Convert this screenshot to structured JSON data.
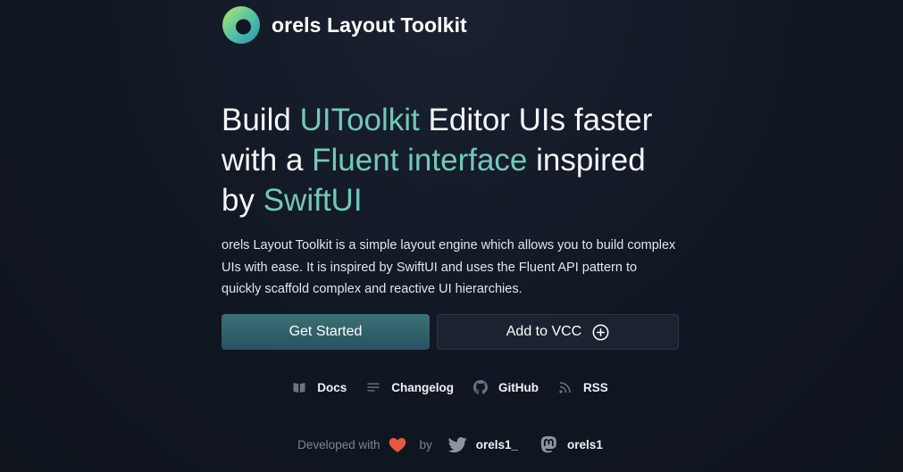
{
  "brand": {
    "name": "orels Layout Toolkit",
    "icon": "logo-ring-icon"
  },
  "headline": {
    "p1": "Build ",
    "h1": "UIToolkit",
    "p2": " Editor UIs faster with a ",
    "h2": "Fluent interface",
    "p3": " inspired by ",
    "h3": "SwiftUI"
  },
  "description": "orels Layout Toolkit is a simple layout engine which allows you to build complex UIs with ease. It is inspired by SwiftUI and uses the Fluent API pattern to quickly scaffold complex and reactive UI hierarchies.",
  "buttons": {
    "primary": "Get Started",
    "secondary": "Add to VCC",
    "secondary_icon": "plus-circle-icon"
  },
  "links": [
    {
      "label": "Docs",
      "icon": "book-icon"
    },
    {
      "label": "Changelog",
      "icon": "list-icon"
    },
    {
      "label": "GitHub",
      "icon": "github-icon"
    },
    {
      "label": "RSS",
      "icon": "rss-icon"
    }
  ],
  "footer": {
    "developed_with": "Developed with",
    "by": "by",
    "twitter": "orels1_",
    "mastodon": "orels1",
    "heart_icon": "heart-icon"
  },
  "colors": {
    "accent": "#72c9b7",
    "heart": "#e8583f",
    "background": "#111722"
  }
}
